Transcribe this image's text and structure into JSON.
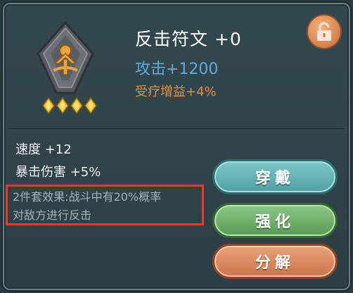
{
  "item": {
    "name": "反击符文 +0",
    "attack": "攻击+1200",
    "heal_bonus": "受疗增益+4%",
    "stars": 4
  },
  "stats": {
    "speed": "速度 +12",
    "crit_damage": "暴击伤害 +5%"
  },
  "set_effect": {
    "line1": "2件套效果:战斗中有20%概率",
    "line2": "对敌方进行反击"
  },
  "buttons": {
    "wear": "穿戴",
    "enhance": "强化",
    "break": "分解"
  },
  "icons": {
    "rune": "counter-rune-icon",
    "star": "diamond-star-icon",
    "lock": "padlock-icon"
  },
  "colors": {
    "attack": "#61a9da",
    "heal": "#e39142",
    "highlight_box": "#e53935",
    "wear_button": "#62b3b5",
    "enhance_button": "#72b06b",
    "break_button": "#d98b5f"
  }
}
